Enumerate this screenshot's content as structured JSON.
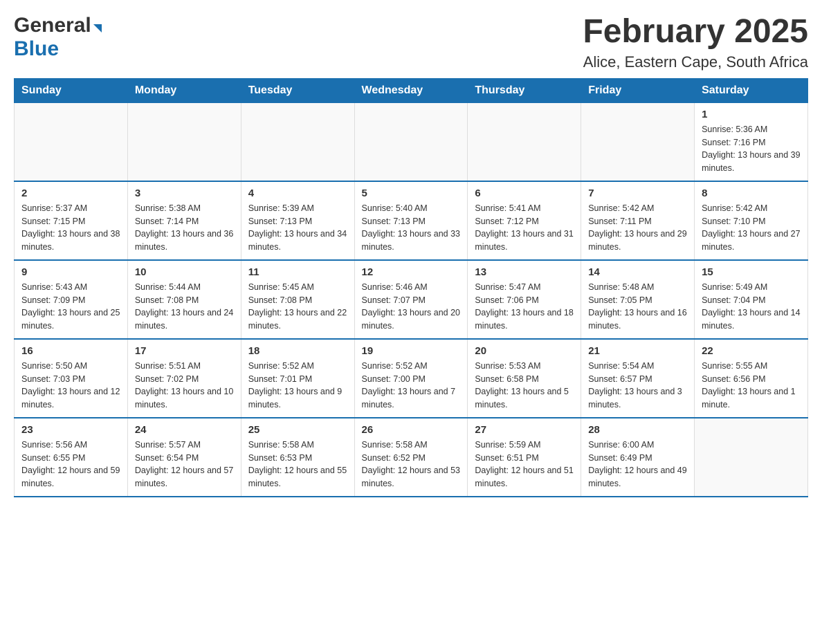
{
  "header": {
    "logo_general": "General",
    "logo_blue": "Blue",
    "month_year": "February 2025",
    "location": "Alice, Eastern Cape, South Africa"
  },
  "days_of_week": [
    "Sunday",
    "Monday",
    "Tuesday",
    "Wednesday",
    "Thursday",
    "Friday",
    "Saturday"
  ],
  "weeks": [
    {
      "days": [
        {
          "num": "",
          "info": ""
        },
        {
          "num": "",
          "info": ""
        },
        {
          "num": "",
          "info": ""
        },
        {
          "num": "",
          "info": ""
        },
        {
          "num": "",
          "info": ""
        },
        {
          "num": "",
          "info": ""
        },
        {
          "num": "1",
          "info": "Sunrise: 5:36 AM\nSunset: 7:16 PM\nDaylight: 13 hours and 39 minutes."
        }
      ]
    },
    {
      "days": [
        {
          "num": "2",
          "info": "Sunrise: 5:37 AM\nSunset: 7:15 PM\nDaylight: 13 hours and 38 minutes."
        },
        {
          "num": "3",
          "info": "Sunrise: 5:38 AM\nSunset: 7:14 PM\nDaylight: 13 hours and 36 minutes."
        },
        {
          "num": "4",
          "info": "Sunrise: 5:39 AM\nSunset: 7:13 PM\nDaylight: 13 hours and 34 minutes."
        },
        {
          "num": "5",
          "info": "Sunrise: 5:40 AM\nSunset: 7:13 PM\nDaylight: 13 hours and 33 minutes."
        },
        {
          "num": "6",
          "info": "Sunrise: 5:41 AM\nSunset: 7:12 PM\nDaylight: 13 hours and 31 minutes."
        },
        {
          "num": "7",
          "info": "Sunrise: 5:42 AM\nSunset: 7:11 PM\nDaylight: 13 hours and 29 minutes."
        },
        {
          "num": "8",
          "info": "Sunrise: 5:42 AM\nSunset: 7:10 PM\nDaylight: 13 hours and 27 minutes."
        }
      ]
    },
    {
      "days": [
        {
          "num": "9",
          "info": "Sunrise: 5:43 AM\nSunset: 7:09 PM\nDaylight: 13 hours and 25 minutes."
        },
        {
          "num": "10",
          "info": "Sunrise: 5:44 AM\nSunset: 7:08 PM\nDaylight: 13 hours and 24 minutes."
        },
        {
          "num": "11",
          "info": "Sunrise: 5:45 AM\nSunset: 7:08 PM\nDaylight: 13 hours and 22 minutes."
        },
        {
          "num": "12",
          "info": "Sunrise: 5:46 AM\nSunset: 7:07 PM\nDaylight: 13 hours and 20 minutes."
        },
        {
          "num": "13",
          "info": "Sunrise: 5:47 AM\nSunset: 7:06 PM\nDaylight: 13 hours and 18 minutes."
        },
        {
          "num": "14",
          "info": "Sunrise: 5:48 AM\nSunset: 7:05 PM\nDaylight: 13 hours and 16 minutes."
        },
        {
          "num": "15",
          "info": "Sunrise: 5:49 AM\nSunset: 7:04 PM\nDaylight: 13 hours and 14 minutes."
        }
      ]
    },
    {
      "days": [
        {
          "num": "16",
          "info": "Sunrise: 5:50 AM\nSunset: 7:03 PM\nDaylight: 13 hours and 12 minutes."
        },
        {
          "num": "17",
          "info": "Sunrise: 5:51 AM\nSunset: 7:02 PM\nDaylight: 13 hours and 10 minutes."
        },
        {
          "num": "18",
          "info": "Sunrise: 5:52 AM\nSunset: 7:01 PM\nDaylight: 13 hours and 9 minutes."
        },
        {
          "num": "19",
          "info": "Sunrise: 5:52 AM\nSunset: 7:00 PM\nDaylight: 13 hours and 7 minutes."
        },
        {
          "num": "20",
          "info": "Sunrise: 5:53 AM\nSunset: 6:58 PM\nDaylight: 13 hours and 5 minutes."
        },
        {
          "num": "21",
          "info": "Sunrise: 5:54 AM\nSunset: 6:57 PM\nDaylight: 13 hours and 3 minutes."
        },
        {
          "num": "22",
          "info": "Sunrise: 5:55 AM\nSunset: 6:56 PM\nDaylight: 13 hours and 1 minute."
        }
      ]
    },
    {
      "days": [
        {
          "num": "23",
          "info": "Sunrise: 5:56 AM\nSunset: 6:55 PM\nDaylight: 12 hours and 59 minutes."
        },
        {
          "num": "24",
          "info": "Sunrise: 5:57 AM\nSunset: 6:54 PM\nDaylight: 12 hours and 57 minutes."
        },
        {
          "num": "25",
          "info": "Sunrise: 5:58 AM\nSunset: 6:53 PM\nDaylight: 12 hours and 55 minutes."
        },
        {
          "num": "26",
          "info": "Sunrise: 5:58 AM\nSunset: 6:52 PM\nDaylight: 12 hours and 53 minutes."
        },
        {
          "num": "27",
          "info": "Sunrise: 5:59 AM\nSunset: 6:51 PM\nDaylight: 12 hours and 51 minutes."
        },
        {
          "num": "28",
          "info": "Sunrise: 6:00 AM\nSunset: 6:49 PM\nDaylight: 12 hours and 49 minutes."
        },
        {
          "num": "",
          "info": ""
        }
      ]
    }
  ]
}
